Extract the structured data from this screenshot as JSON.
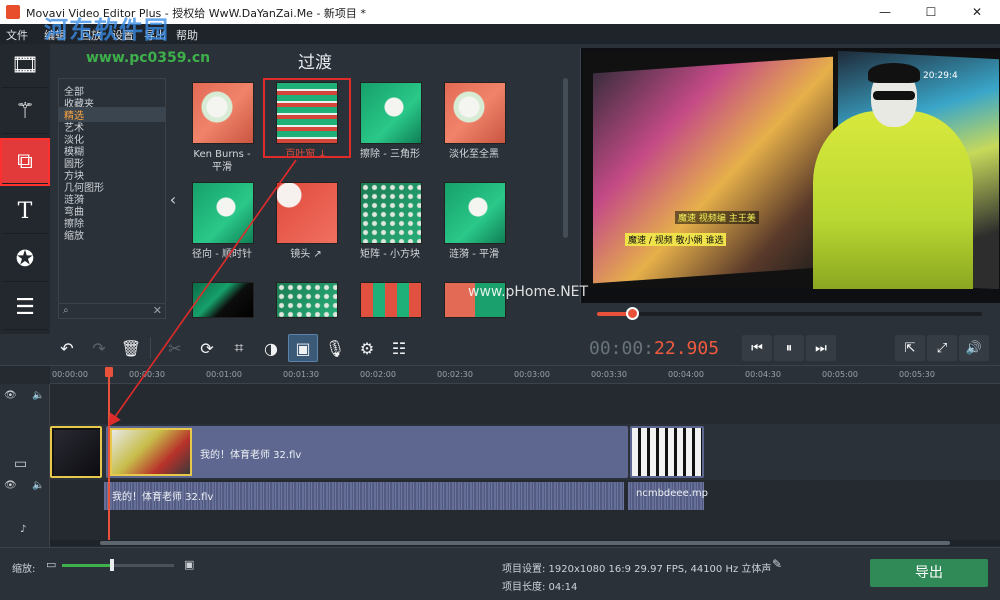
{
  "window": {
    "title": "Movavi Video Editor Plus - 授权给 WwW.DaYanZai.Me - 新项目 *",
    "minimize": "—",
    "maximize": "☐",
    "close": "✕"
  },
  "watermarks": {
    "site_name": "河东软件园",
    "site_url": "www.pc0359.cn",
    "player_watermark": "www.pHome.NET"
  },
  "menu": [
    "文件",
    "编辑",
    "回放",
    "设置",
    "导出",
    "帮助"
  ],
  "left_tools": [
    {
      "name": "import",
      "icon": "film-import-icon"
    },
    {
      "name": "filters",
      "icon": "magic-wand-icon"
    },
    {
      "name": "transitions",
      "icon": "transition-icon",
      "active": true
    },
    {
      "name": "titles",
      "icon": "text-icon"
    },
    {
      "name": "stickers",
      "icon": "star-icon"
    },
    {
      "name": "more",
      "icon": "list-icon"
    }
  ],
  "categories": [
    "全部",
    "收藏夹",
    "精选",
    "艺术",
    "淡化",
    "模糊",
    "圆形",
    "方块",
    "几何图形",
    "涟漪",
    "弯曲",
    "擦除",
    "缩放"
  ],
  "selected_category": "精选",
  "panel_title": "过渡",
  "transitions": [
    {
      "label": "Ken Burns -\n平滑",
      "style": "t-flower"
    },
    {
      "label": "百叶窗 ↓",
      "style": "t-stripes"
    },
    {
      "label": "擦除 - 三角形",
      "style": "t-green"
    },
    {
      "label": "淡化至全黑",
      "style": "t-flower"
    },
    {
      "label": "径向 - 顺时针",
      "style": "t-green"
    },
    {
      "label": "镜头 ↗",
      "style": "t-red"
    },
    {
      "label": "矩阵 - 小方块",
      "style": "t-dots"
    },
    {
      "label": "涟漪 - 平滑",
      "style": "t-green"
    },
    {
      "label": "",
      "style": "t-dark"
    },
    {
      "label": "",
      "style": "t-dots"
    },
    {
      "label": "",
      "style": "t-blocks"
    },
    {
      "label": "",
      "style": "t-half"
    }
  ],
  "player": {
    "timecode_prefix": "00:00:",
    "timecode_seconds": "22.905",
    "progress": 0.09,
    "caption_line1": "魔速 视频编 主王美",
    "caption_line2": "魔速 / 视频 敬小娴 谁选",
    "clock": "20:29:4"
  },
  "edit_tools": [
    "undo",
    "redo",
    "delete",
    "cut",
    "rotate",
    "crop",
    "color-adjust",
    "image",
    "record-audio",
    "settings",
    "equalizer"
  ],
  "timeline": {
    "ticks": [
      "00:00:00",
      "00:00:30",
      "00:01:00",
      "00:01:30",
      "00:02:00",
      "00:02:30",
      "00:03:00",
      "00:03:30",
      "00:04:00",
      "00:04:30",
      "00:05:00",
      "00:05:30"
    ],
    "clips": [
      {
        "name": "",
        "kind": "dark"
      },
      {
        "name": "我的！体育老师 32.flv",
        "kind": "main"
      },
      {
        "name": "",
        "kind": "piano"
      }
    ],
    "audio_clips": [
      "我的！体育老师 32.flv",
      "ncmbdeee.mp"
    ]
  },
  "bottom": {
    "zoom_label": "缩放:",
    "zoom_level": 0.45,
    "project_settings": "项目设置:  1920x1080 16:9 29.97 FPS, 44100 Hz 立体声",
    "project_length": "项目长度:  04:14",
    "export_label": "导出"
  },
  "colors": {
    "accent": "#e8523b",
    "export_green": "#2f8a57",
    "highlight_red": "#e02b2b",
    "selected_category": "#ffa640"
  }
}
